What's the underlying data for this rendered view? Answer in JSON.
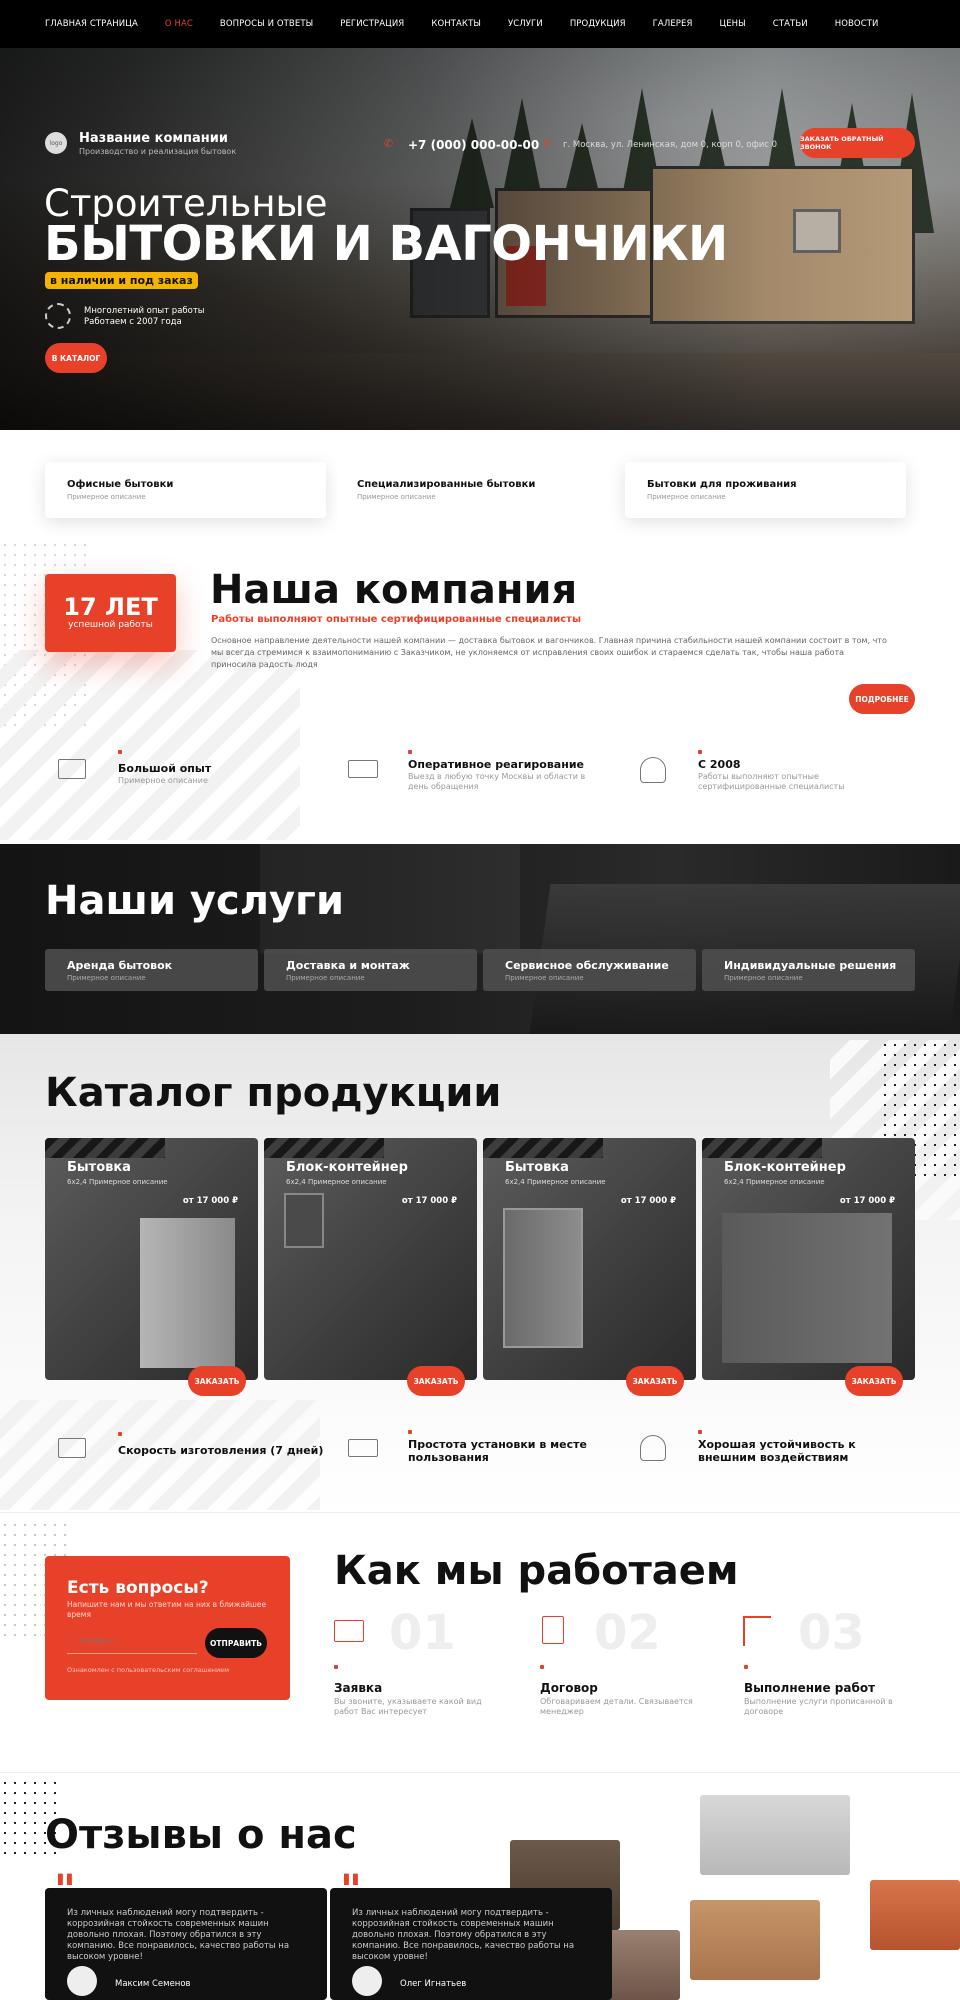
{
  "nav": {
    "items": [
      "Главная страница",
      "О нас",
      "Вопросы и ответы",
      "Регистрация",
      "Контакты",
      "Услуги",
      "Продукция",
      "Галерея",
      "Цены",
      "Статьи",
      "Новости"
    ],
    "active_index": 1
  },
  "header": {
    "logo_text": "logo",
    "company_name": "Название компании",
    "company_tagline": "Производство и реализация бытовок",
    "phone": "+7 (000) 000-00-00",
    "address": "г. Москва, ул. Ленинская, дом 0, корп 0, офис 0",
    "callback_button": "Заказать обратный звонок"
  },
  "hero": {
    "title_line1": "Строительные",
    "title_line2": "БЫТОВКИ И ВАГОНЧИКИ",
    "badge": "в наличии и под заказ",
    "experience_line1": "Многолетний опыт работы",
    "experience_line2": "Работаем с 2007 года",
    "catalog_button": "В каталог"
  },
  "categories": [
    {
      "title": "Офисные бытовки",
      "subtitle": "Примерное описание"
    },
    {
      "title": "Специализированные бытовки",
      "subtitle": "Примерное описание"
    },
    {
      "title": "Бытовки для проживания",
      "subtitle": "Примерное описание"
    }
  ],
  "company": {
    "years_value": "17 ЛЕТ",
    "years_label": "успешной работы",
    "title": "Наша компания",
    "subtitle": "Работы выполняют опытные сертифицированные специалисты",
    "description": "Основное направление деятельности нашей компании — доставка бытовок и вагончиков. Главная причина стабильности нашей компании состоит в том, что мы всегда стремимся к взаимопониманию с Заказчиком, не уклоняемся от исправления своих ошибок и стараемся сделать так, чтобы наша работа приносила радость людя",
    "more_button": "Подробнее",
    "features": [
      {
        "title": "Большой опыт",
        "subtitle": "Примерное описание",
        "icon": "certificate-icon"
      },
      {
        "title": "Оперативное реагирование",
        "subtitle": "Выезд в любую точку Москвы и области в день обращения",
        "icon": "truck-icon"
      },
      {
        "title": "С 2008",
        "subtitle": "Работы выполняют опытные сертифицированные специалисты",
        "icon": "worker-icon"
      }
    ]
  },
  "services": {
    "title": "Наши услуги",
    "items": [
      {
        "title": "Аренда бытовок",
        "subtitle": "Примерное описание"
      },
      {
        "title": "Доставка и монтаж",
        "subtitle": "Примерное описание"
      },
      {
        "title": "Сервисное обслуживание",
        "subtitle": "Примерное описание"
      },
      {
        "title": "Индивидуальные решения",
        "subtitle": "Примерное описание"
      }
    ]
  },
  "catalog": {
    "title": "Каталог продукции",
    "products": [
      {
        "title": "Бытовка",
        "subtitle": "6х2,4 Примерное описание",
        "price": "от 17 000 ₽",
        "button": "Заказать"
      },
      {
        "title": "Блок-контейнер",
        "subtitle": "6х2,4 Примерное описание",
        "price": "от 17 000 ₽",
        "button": "Заказать"
      },
      {
        "title": "Бытовка",
        "subtitle": "6х2,4 Примерное описание",
        "price": "от 17 000 ₽",
        "button": "Заказать"
      },
      {
        "title": "Блок-контейнер",
        "subtitle": "6х2,4 Примерное описание",
        "price": "от 17 000 ₽",
        "button": "Заказать"
      }
    ],
    "features": [
      {
        "title": "Скорость изготовления (7 дней)",
        "icon": "certificate-icon"
      },
      {
        "title": "Простота установки в месте пользования",
        "icon": "truck-icon"
      },
      {
        "title": "Хорошая устойчивость к внешним воздействиям",
        "icon": "worker-icon"
      }
    ]
  },
  "contact_form": {
    "title": "Есть вопросы?",
    "subtitle": "Напишите нам и мы ответим на них в ближайшее время",
    "phone_placeholder": "Телефон *",
    "submit_button": "Отправить",
    "agreement": "Ознакомлен с пользовательским соглашением"
  },
  "how": {
    "title": "Как мы работаем",
    "steps": [
      {
        "number": "01",
        "title": "Заявка",
        "subtitle": "Вы звоните, указываете какой вид работ Вас интересует",
        "icon": "envelope-icon"
      },
      {
        "number": "02",
        "title": "Договор",
        "subtitle": "Обговариваем детали. Связывается менеджер",
        "icon": "document-icon"
      },
      {
        "number": "03",
        "title": "Выполнение работ",
        "subtitle": "Выполнение услуги прописанной в договоре",
        "icon": "crane-icon"
      }
    ]
  },
  "reviews": {
    "title": "Отзывы о нас",
    "items": [
      {
        "text": "Из личных наблюдений могу подтвердить - коррозийная стойкость современных машин довольно плохая. Поэтому обратился в эту компанию. Все понравилось, качество работы на высоком уровне!",
        "author": "Максим Семенов"
      },
      {
        "text": "Из личных наблюдений могу подтвердить - коррозийная стойкость современных машин довольно плохая. Поэтому обратился в эту компанию. Все понравилось, качество работы на высоком уровне!",
        "author": "Олег Игнатьев"
      }
    ]
  },
  "colors": {
    "accent": "#e8412a",
    "badge": "#f5b400",
    "dark": "#111111"
  }
}
